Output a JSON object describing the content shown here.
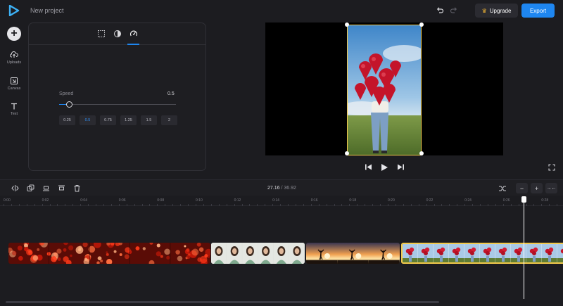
{
  "header": {
    "project_title": "New project",
    "upgrade_label": "Upgrade",
    "export_label": "Export",
    "accent": "#1e86f0"
  },
  "rail": {
    "items": [
      {
        "label": "Uploads",
        "icon": "upload-icon"
      },
      {
        "label": "Canvas",
        "icon": "canvas-icon"
      },
      {
        "label": "Text",
        "icon": "text-icon"
      }
    ]
  },
  "panel": {
    "tabs": [
      "crop-icon",
      "filter-icon",
      "speed-icon"
    ],
    "active_tab": 2,
    "speed_label": "Speed",
    "speed_value": "0.5",
    "slider_fraction": 0.09,
    "presets": [
      "0.25",
      "0.5",
      "0.75",
      "1.25",
      "1.5",
      "2"
    ],
    "active_preset": "0.5"
  },
  "timeline": {
    "current_time": "27.16",
    "separator": "/",
    "total_time": "36.92",
    "ruler": [
      "0:00",
      "0:02",
      "0:04",
      "0:06",
      "0:08",
      "0:10",
      "0:12",
      "0:14",
      "0:16",
      "0:18",
      "0:20",
      "0:22",
      "0:24",
      "0:26",
      "0:28"
    ],
    "zoom_out": "−",
    "zoom_in": "+",
    "fit": "→←",
    "clips": [
      {
        "name": "bokeh-lights-clip",
        "theme": "bokeh"
      },
      {
        "name": "woman-portrait-clip",
        "theme": "portrait"
      },
      {
        "name": "sunset-silhouette-clip",
        "theme": "sunset"
      },
      {
        "name": "balloons-field-clip",
        "theme": "balloons",
        "selected": true
      }
    ]
  }
}
